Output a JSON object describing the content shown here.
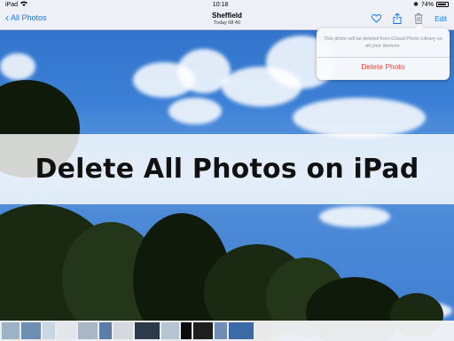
{
  "status": {
    "device": "iPad",
    "time": "10:18",
    "battery": "74%"
  },
  "nav": {
    "back_label": "All Photos",
    "title": "Sheffield",
    "subtitle": "Today  08:40",
    "edit_label": "Edit",
    "icons": [
      "heart-icon",
      "share-icon",
      "trash-icon"
    ]
  },
  "popover": {
    "message": "This photo will be deleted from iCloud Photo Library on all your devices.",
    "delete_label": "Delete Photo"
  },
  "banner": {
    "text": "Delete All Photos on iPad"
  },
  "strip": {
    "thumbnail_colors": [
      "#9fb3c8",
      "#6d8fb1",
      "#c9d6e3",
      "#e3e7ec",
      "#a7b7c6",
      "#5c7ea6",
      "#d5d9de",
      "#2c3a4b",
      "#b7c4d2",
      "#0b0b0b",
      "#1e1e1e",
      "#6f8db5",
      "#3c6aa6",
      "#e9e9ea"
    ]
  },
  "colors": {
    "accent": "#0a7aff",
    "destructive": "#ff3b30"
  }
}
